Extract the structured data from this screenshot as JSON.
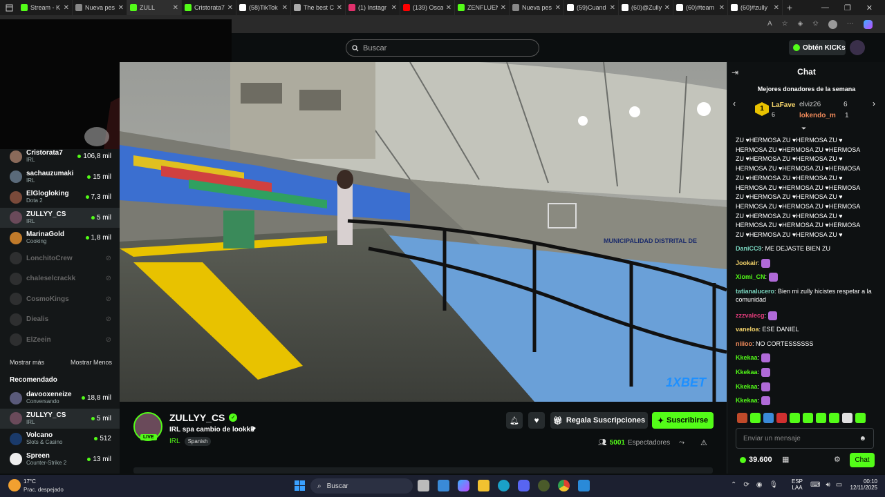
{
  "browser": {
    "tabs": [
      {
        "label": "Stream - K",
        "color": "#53fc18"
      },
      {
        "label": "Nueva pes",
        "color": "#888888"
      },
      {
        "label": "ZULL",
        "color": "#53fc18"
      },
      {
        "label": "Cristorata7",
        "color": "#53fc18"
      },
      {
        "label": "(58)TikTok",
        "color": "#ffffff"
      },
      {
        "label": "The best C",
        "color": "#aaaaaa"
      },
      {
        "label": "(1) Instagr",
        "color": "#e1306c"
      },
      {
        "label": "(139) Osca",
        "color": "#ff0000"
      },
      {
        "label": "ZENFLUEN",
        "color": "#53fc18"
      },
      {
        "label": "Nueva pes",
        "color": "#888888"
      },
      {
        "label": "(59)Cuand",
        "color": "#ffffff"
      },
      {
        "label": "(60)@Zully",
        "color": "#ffffff"
      },
      {
        "label": "(60)#team",
        "color": "#ffffff"
      },
      {
        "label": "(60)#zully",
        "color": "#ffffff"
      }
    ]
  },
  "header": {
    "search_placeholder": "Buscar",
    "kicks_label": "Obtén KICKs"
  },
  "sidebar": {
    "following": [
      {
        "name": "Cristorata7",
        "category": "IRL",
        "viewers": "106,8 mil",
        "online": true,
        "color": "#8a6a5a"
      },
      {
        "name": "sachauzumaki",
        "category": "IRL",
        "viewers": "15 mil",
        "online": true,
        "color": "#5a6a7a"
      },
      {
        "name": "ElGlogloking",
        "category": "Dota 2",
        "viewers": "7,3 mil",
        "online": true,
        "color": "#7a4a3a"
      },
      {
        "name": "ZULLYY_CS",
        "category": "IRL",
        "viewers": "5 mil",
        "online": true,
        "color": "#6a4a5a"
      },
      {
        "name": "MarinaGold",
        "category": "Cooking",
        "viewers": "1,8 mil",
        "online": true,
        "color": "#c07a2a"
      },
      {
        "name": "LonchitoCrew",
        "category": "",
        "viewers": "",
        "online": false,
        "color": "#555555"
      },
      {
        "name": "chaleselcrackk",
        "category": "",
        "viewers": "",
        "online": false,
        "color": "#555555"
      },
      {
        "name": "CosmoKings",
        "category": "",
        "viewers": "",
        "online": false,
        "color": "#555555"
      },
      {
        "name": "Diealis",
        "category": "",
        "viewers": "",
        "online": false,
        "color": "#555555"
      },
      {
        "name": "ElZeein",
        "category": "",
        "viewers": "",
        "online": false,
        "color": "#555555"
      }
    ],
    "show_more": "Mostrar más",
    "show_less": "Mostrar Menos",
    "recommended_title": "Recomendado",
    "recommended": [
      {
        "name": "davooxeneize",
        "category": "Conversando",
        "viewers": "18,8 mil",
        "color": "#5a5a7a"
      },
      {
        "name": "ZULLYY_CS",
        "category": "IRL",
        "viewers": "5 mil",
        "color": "#6a4a5a"
      },
      {
        "name": "Volcano",
        "category": "Slots & Casino",
        "viewers": "512",
        "color": "#1a3a6a"
      },
      {
        "name": "Spreen",
        "category": "Counter-Strike 2",
        "viewers": "13 mil",
        "color": "#eeeeee"
      }
    ]
  },
  "video": {
    "watermark": "1XBET",
    "wall_text": "MUNICIPALIDAD DISTRITAL DE"
  },
  "stream": {
    "channel": "ZULLYY_CS",
    "title": "IRL spa cambio de lookkk",
    "category": "IRL",
    "tag": "Spanish",
    "live_badge": "LIVE",
    "gift_label": "Regala Suscripciones",
    "subscribe_label": "Suscribirse",
    "viewers_count": "5001",
    "viewers_label": "Espectadores"
  },
  "chat": {
    "title": "Chat",
    "leaderboard_title": "Mejores donadores de la semana",
    "top1_name": "LaFave",
    "top1_count": "6",
    "top2_name": "elviz26",
    "top2_count": "6",
    "top3_name": "lokendo_m",
    "top3_count": "1",
    "spam_lines": [
      "ZU ♥HERMOSA ZU ♥HERMOSA ZU ♥",
      "HERMOSA ZU ♥HERMOSA ZU ♥HERMOSA",
      "ZU ♥HERMOSA ZU ♥HERMOSA ZU ♥",
      "HERMOSA ZU ♥HERMOSA ZU ♥HERMOSA",
      "ZU ♥HERMOSA ZU ♥HERMOSA ZU ♥",
      "HERMOSA ZU ♥HERMOSA ZU ♥HERMOSA",
      "ZU ♥HERMOSA ZU ♥HERMOSA ZU ♥",
      "HERMOSA ZU ♥HERMOSA ZU ♥HERMOSA",
      "ZU ♥HERMOSA ZU ♥HERMOSA ZU ♥",
      "HERMOSA ZU ♥HERMOSA ZU ♥HERMOSA",
      "ZU ♥HERMOSA ZU ♥HERMOSA ZU ♥"
    ],
    "messages": [
      {
        "user": "DaniCC9",
        "color": "#7ad7c0",
        "text": "ME DEJASTE BIEN ZU"
      },
      {
        "user": "Jookair",
        "color": "#f3d36a",
        "text": ""
      },
      {
        "user": "Xiomi_CN",
        "color": "#53fc18",
        "text": ""
      },
      {
        "user": "tatianalucero",
        "color": "#7ad7c0",
        "text": "Bien mi zully hicistes respetar a la comunidad"
      },
      {
        "user": "zzzvalecg",
        "color": "#e03c7a",
        "text": ""
      },
      {
        "user": "vaneloa",
        "color": "#f3d36a",
        "text": "ESE DANIEL"
      },
      {
        "user": "niiioo",
        "color": "#f08a5a",
        "text": "NO CORTESSSSSS"
      },
      {
        "user": "Kkekaa",
        "color": "#53fc18",
        "text": ""
      },
      {
        "user": "Kkekaa",
        "color": "#53fc18",
        "text": ""
      },
      {
        "user": "Kkekaa",
        "color": "#53fc18",
        "text": ""
      },
      {
        "user": "Kkekaa",
        "color": "#53fc18",
        "text": ""
      }
    ],
    "input_placeholder": "Enviar un mensaje",
    "balance": "39.600",
    "send_label": "Chat"
  },
  "taskbar": {
    "temp": "17°C",
    "weather": "Prac. despejado",
    "search": "Buscar",
    "lang": "ESP",
    "lang2": "LAA",
    "time": "00:10",
    "date": "12/11/2025"
  },
  "colors": {
    "accent": "#53fc18",
    "bg": "#0b0e0f"
  }
}
